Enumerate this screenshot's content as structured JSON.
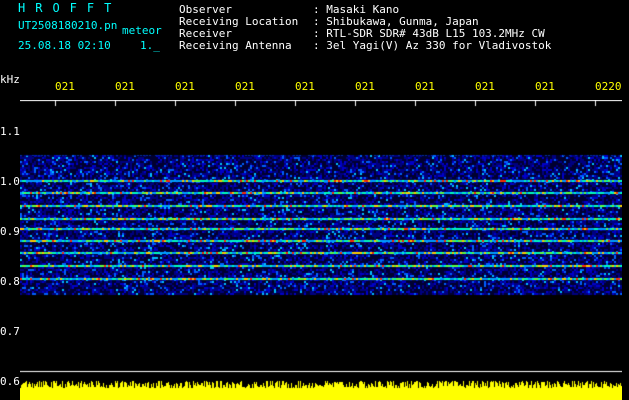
{
  "app": {
    "title": "HROFFT",
    "filename": "UT2508180210.pn",
    "mode": "meteor",
    "datetime": "25.08.18 02:10",
    "level": "1._"
  },
  "info": {
    "observer_label": "Observer",
    "observer_value": ": Masaki Kano",
    "location_label": "Receiving Location",
    "location_value": ": Shibukawa, Gunma, Japan",
    "receiver_label": "Receiver",
    "receiver_value": ": RTL-SDR SDR# 43dB L15 103.2MHz CW",
    "antenna_label": "Receiving Antenna",
    "antenna_value": ": 3el Yagi(V) Az 330 for Vladivostok"
  },
  "axis": {
    "unit": "kHz",
    "y_ticks": [
      "1.1",
      "1.0",
      "0.9",
      "0.8",
      "0.7",
      "0.6"
    ],
    "x_ticks": [
      "021",
      "021",
      "021",
      "021",
      "021",
      "021",
      "021",
      "021",
      "021",
      "0220"
    ]
  },
  "colors": {
    "background": "#000000",
    "header_label": "#00ffff",
    "time_axis": "#ffff00",
    "spectrum_low": "#000060",
    "spectrum_high": "#ff3000",
    "signal_bar": "#ffff00"
  }
}
